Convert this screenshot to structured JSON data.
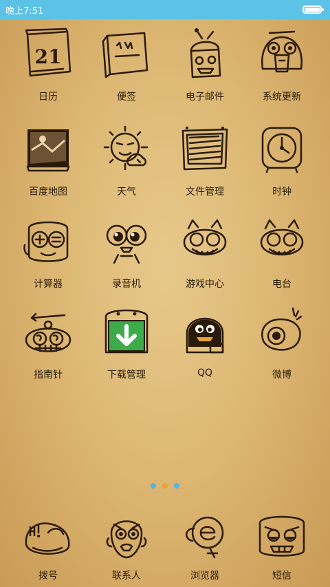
{
  "status_bar": {
    "time": "晚上7:51",
    "battery_level": 0.9,
    "color": "#5cc3e6"
  },
  "apps": [
    {
      "label": "日历",
      "icon": "calendar-icon",
      "calendar_day": "21"
    },
    {
      "label": "便签",
      "icon": "notes-icon"
    },
    {
      "label": "电子邮件",
      "icon": "email-icon"
    },
    {
      "label": "系统更新",
      "icon": "system-update-icon"
    },
    {
      "label": "百度地图",
      "icon": "baidu-map-icon"
    },
    {
      "label": "天气",
      "icon": "weather-icon"
    },
    {
      "label": "文件管理",
      "icon": "file-manager-icon"
    },
    {
      "label": "时钟",
      "icon": "clock-icon"
    },
    {
      "label": "计算器",
      "icon": "calculator-icon"
    },
    {
      "label": "录音机",
      "icon": "recorder-icon"
    },
    {
      "label": "游戏中心",
      "icon": "game-center-icon"
    },
    {
      "label": "电台",
      "icon": "radio-icon"
    },
    {
      "label": "指南针",
      "icon": "compass-icon"
    },
    {
      "label": "下载管理",
      "icon": "download-manager-icon"
    },
    {
      "label": "QQ",
      "icon": "qq-icon"
    },
    {
      "label": "微博",
      "icon": "weibo-icon"
    }
  ],
  "page_indicator": {
    "pages": 3,
    "current": 2,
    "active_color": "#e9a23b",
    "inactive_color": "#4fb7e6"
  },
  "dock": [
    {
      "label": "拨号",
      "icon": "dialer-icon"
    },
    {
      "label": "联系人",
      "icon": "contacts-icon"
    },
    {
      "label": "浏览器",
      "icon": "browser-icon"
    },
    {
      "label": "短信",
      "icon": "messages-icon"
    }
  ],
  "colors": {
    "wallpaper": "#ddb874",
    "ink": "#2a1a0a",
    "download_green": "#3dab4a"
  }
}
